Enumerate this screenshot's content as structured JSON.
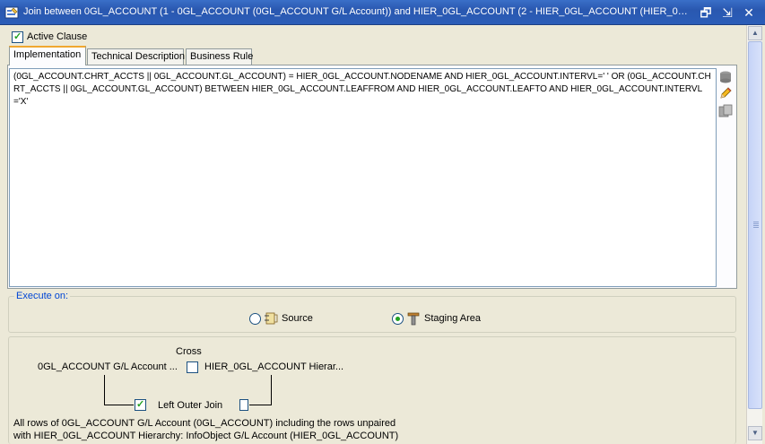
{
  "window": {
    "title": "Join between 0GL_ACCOUNT (1 - 0GL_ACCOUNT (0GL_ACCOUNT G/L Account)) and HIER_0GL_ACCOUNT (2 - HIER_0GL_ACCOUNT (HIER_0GL_ACCOU...",
    "restore_glyph": "🗗",
    "pin_glyph": "⇲",
    "close_glyph": "✕"
  },
  "active_clause": {
    "label": "Active Clause",
    "checked": true
  },
  "tabs": [
    {
      "label": "Implementation",
      "active": true
    },
    {
      "label": "Technical Description",
      "active": false
    },
    {
      "label": "Business Rule",
      "active": false
    }
  ],
  "editor": {
    "text": "(0GL_ACCOUNT.CHRT_ACCTS || 0GL_ACCOUNT.GL_ACCOUNT) = HIER_0GL_ACCOUNT.NODENAME AND HIER_0GL_ACCOUNT.INTERVL=' ' OR (0GL_ACCOUNT.CHRT_ACCTS || 0GL_ACCOUNT.GL_ACCOUNT) BETWEEN HIER_0GL_ACCOUNT.LEAFFROM AND HIER_0GL_ACCOUNT.LEAFTO AND HIER_0GL_ACCOUNT.INTERVL='X'"
  },
  "side_icons": [
    "database-icon",
    "pencil-icon",
    "expression-editor-icon"
  ],
  "execute_on": {
    "legend": "Execute on:",
    "options": [
      {
        "label": "Source",
        "selected": false
      },
      {
        "label": "Staging Area",
        "selected": true
      }
    ]
  },
  "join": {
    "cross_label": "Cross",
    "left_table": "0GL_ACCOUNT G/L Account ...",
    "right_table": "HIER_0GL_ACCOUNT Hierar...",
    "cross_checked": false,
    "left_outer_label": "Left Outer Join",
    "left_outer_checked": true,
    "right_outer_checked": false,
    "description_line1": "All rows of 0GL_ACCOUNT G/L Account (0GL_ACCOUNT) including the rows unpaired",
    "description_line2": "with HIER_0GL_ACCOUNT Hierarchy: InfoObject G/L Account (HIER_0GL_ACCOUNT)"
  },
  "colors": {
    "title_bar": "#2b5db8",
    "tab_highlight": "#f0a830",
    "legend_text": "#0046d5",
    "check_mark": "#21a121"
  }
}
